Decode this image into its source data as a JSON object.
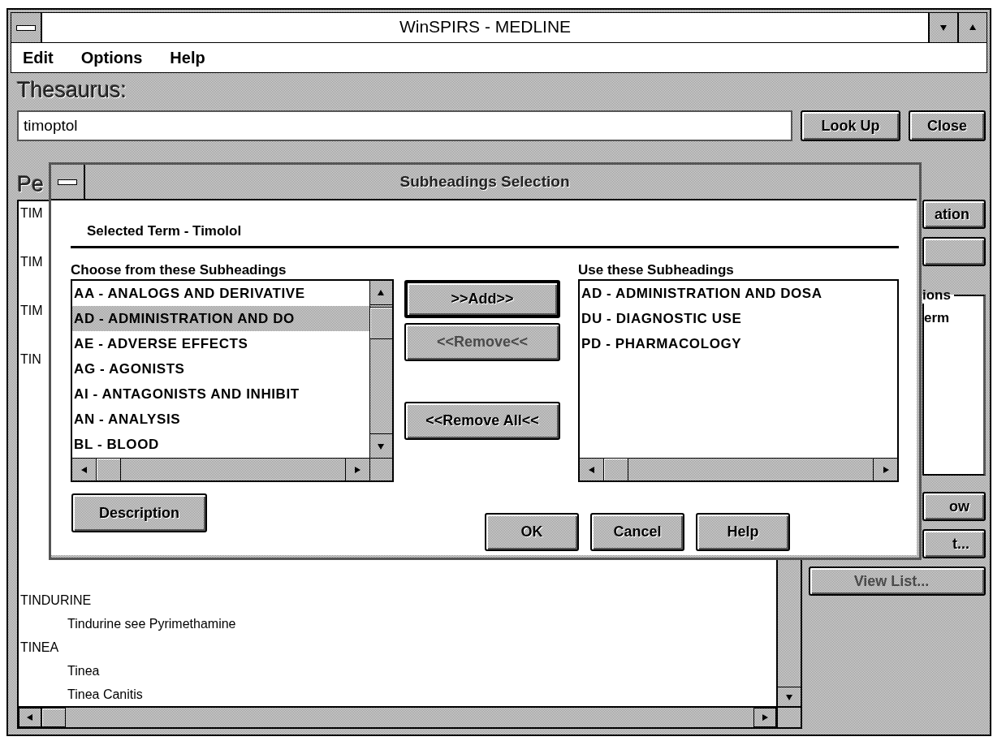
{
  "window": {
    "title": "WinSPIRS - MEDLINE"
  },
  "menu": [
    {
      "label": "Edit"
    },
    {
      "label": "Options"
    },
    {
      "label": "Help"
    }
  ],
  "thesaurus": {
    "label": "Thesaurus:",
    "value": "timoptol",
    "buttons": [
      {
        "label": "Look Up"
      },
      {
        "label": "Close"
      }
    ]
  },
  "results": {
    "label": "Pe",
    "top_rows": [
      {
        "kind": "heading",
        "text": "TIM"
      },
      {
        "kind": "heading",
        "text": "TIM"
      },
      {
        "kind": "heading",
        "text": "TIM"
      },
      {
        "kind": "heading",
        "text": "TIN"
      }
    ],
    "bottom_rows": [
      {
        "kind": "heading",
        "text": "TINDURINE"
      },
      {
        "kind": "entry",
        "text": "Tindurine see Pyrimethamine"
      },
      {
        "kind": "heading",
        "text": "TINEA"
      },
      {
        "kind": "entry",
        "text": "Tinea"
      },
      {
        "kind": "entry",
        "text": "Tinea Canitis"
      }
    ]
  },
  "side_panel": {
    "top_buttons": [
      {
        "label": "ation"
      }
    ],
    "group": {
      "legend": "ions",
      "text": "erm"
    },
    "bottom_buttons": [
      {
        "label": "ow",
        "disabled": false
      },
      {
        "label": "t...",
        "disabled": false
      },
      {
        "label": "View List...",
        "disabled": true
      }
    ]
  },
  "dialog": {
    "title": "Subheadings Selection",
    "selected_term": "Selected Term - Timolol",
    "available": {
      "label": "Choose from these Subheadings",
      "items": [
        {
          "text": "AA - ANALOGS AND DERIVATIVE",
          "selected": false
        },
        {
          "text": "AD - ADMINISTRATION AND DO",
          "selected": true
        },
        {
          "text": "AE - ADVERSE EFFECTS",
          "selected": false
        },
        {
          "text": "AG - AGONISTS",
          "selected": false
        },
        {
          "text": "AI - ANTAGONISTS AND INHIBIT",
          "selected": false
        },
        {
          "text": "AN - ANALYSIS",
          "selected": false
        },
        {
          "text": "BL - BLOOD",
          "selected": false
        }
      ]
    },
    "move_buttons": [
      {
        "label": ">>Add>>",
        "default": true,
        "disabled": false
      },
      {
        "label": "<<Remove<<",
        "default": false,
        "disabled": true
      },
      {
        "label": "<<Remove All<<",
        "default": false,
        "disabled": false
      }
    ],
    "chosen": {
      "label": "Use these Subheadings",
      "items": [
        {
          "text": "AD - ADMINISTRATION AND DOSA",
          "selected": false
        },
        {
          "text": "DU - DIAGNOSTIC USE",
          "selected": false
        },
        {
          "text": "PD - PHARMACOLOGY",
          "selected": false
        }
      ]
    },
    "description_button": {
      "label": "Description"
    },
    "buttons": [
      {
        "label": "OK"
      },
      {
        "label": "Cancel"
      },
      {
        "label": "Help"
      }
    ]
  }
}
